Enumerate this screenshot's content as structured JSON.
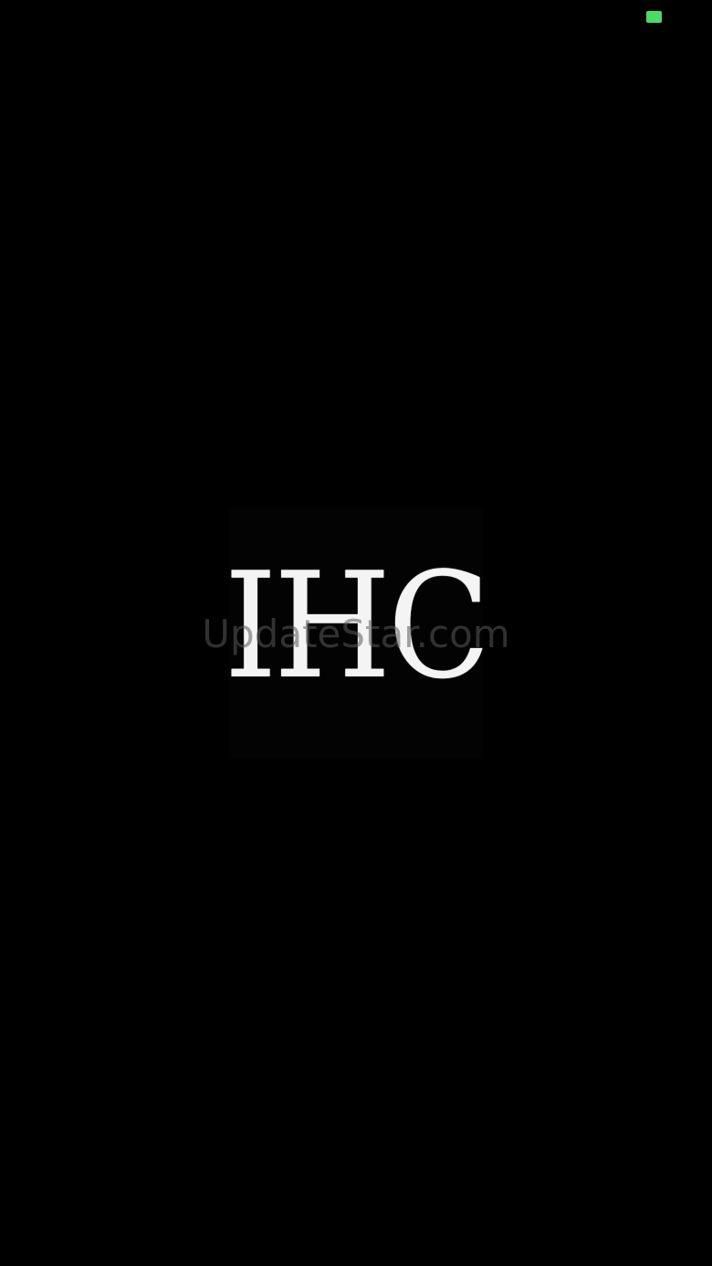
{
  "status_bar": {
    "indicator_color": "#4cd964",
    "indicator_icon": "battery-icon"
  },
  "splash": {
    "logo_text": "IHC",
    "background_color": "#000000",
    "logo_color": "#f4f4f4"
  },
  "watermark": {
    "text": "UpdateStar.com"
  }
}
